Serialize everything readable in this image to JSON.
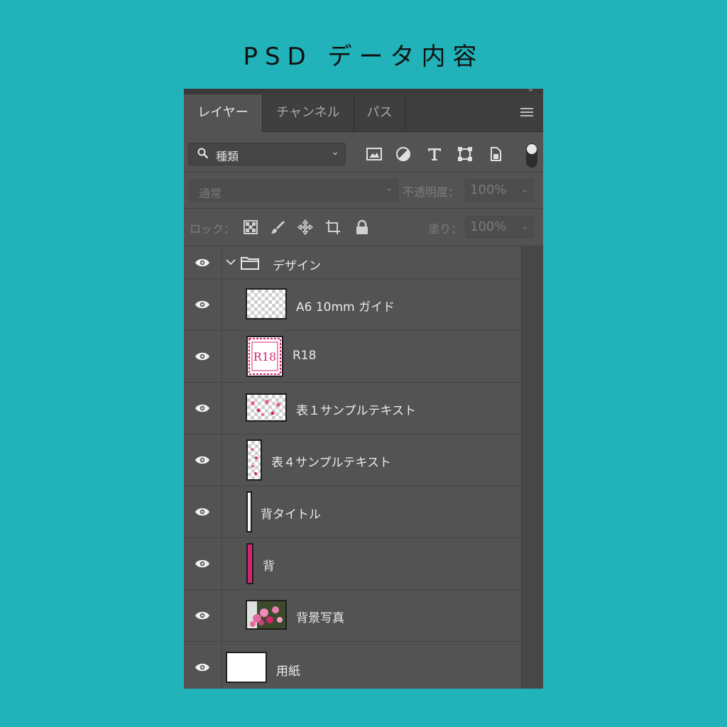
{
  "title": "PSD データ内容",
  "tabs": [
    {
      "label": "レイヤー",
      "active": true
    },
    {
      "label": "チャンネル",
      "active": false
    },
    {
      "label": "パス",
      "active": false
    }
  ],
  "filter": {
    "kind_label": "種類",
    "icons": [
      "image-icon",
      "adjustment-icon",
      "text-icon",
      "shape-icon",
      "smart-object-icon"
    ]
  },
  "blend": {
    "mode": "通常",
    "opacity_label": "不透明度：",
    "opacity_value": "100%"
  },
  "lock": {
    "label": "ロック：",
    "fill_label": "塗り：",
    "fill_value": "100%"
  },
  "layers": [
    {
      "name": "デザイン",
      "type": "group",
      "visible": true,
      "expanded": true
    },
    {
      "name": "A6 10mm ガイド",
      "type": "layer",
      "visible": true
    },
    {
      "name": "R18",
      "type": "layer",
      "visible": true
    },
    {
      "name": "表１サンプルテキスト",
      "type": "layer",
      "visible": true
    },
    {
      "name": "表４サンプルテキスト",
      "type": "layer",
      "visible": true
    },
    {
      "name": "背タイトル",
      "type": "layer",
      "visible": true
    },
    {
      "name": "背",
      "type": "layer",
      "visible": true
    },
    {
      "name": "背景写真",
      "type": "layer",
      "visible": true
    },
    {
      "name": "用紙",
      "type": "layer",
      "visible": true
    }
  ],
  "thumb_text": {
    "r18": "R18"
  },
  "colors": {
    "background": "#21b3b9",
    "panel": "#535353",
    "accent_pink": "#d5246f"
  }
}
